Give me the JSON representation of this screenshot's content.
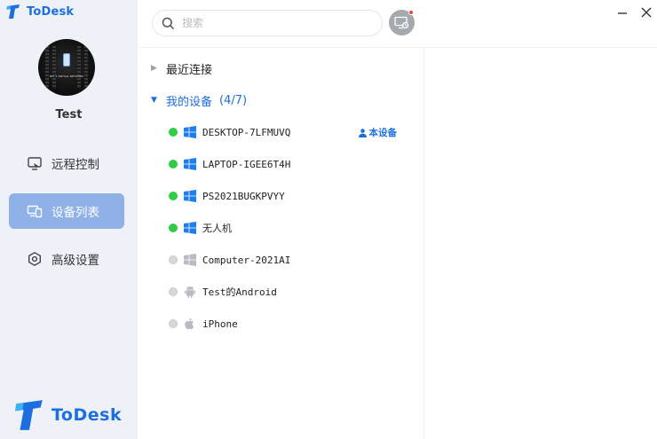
{
  "app": {
    "brand_top": "ToDesk",
    "brand_bottom": "ToDesk",
    "brand_color": "#1d6fe0"
  },
  "user": {
    "name": "Test",
    "avatar_caption": "NO. 1 VIRTUAL NETWORK"
  },
  "sidebar": {
    "items": [
      {
        "label": "远程控制",
        "icon": "remote-control-icon",
        "active": false
      },
      {
        "label": "设备列表",
        "icon": "device-list-icon",
        "active": true
      },
      {
        "label": "高级设置",
        "icon": "settings-icon",
        "active": false
      }
    ]
  },
  "search": {
    "placeholder": "搜索",
    "value": ""
  },
  "header": {
    "remote_button_icon": "remote-desktop-icon",
    "notification_dot": true,
    "minimize_icon": "minimize-icon",
    "close_icon": "close-icon"
  },
  "tree": {
    "recent": {
      "label": "最近连接",
      "expanded": false
    },
    "mine": {
      "label": "我的设备",
      "count": "(4/7)",
      "expanded": true
    },
    "this_device_label": "本设备",
    "devices": [
      {
        "name": "DESKTOP-7LFMUVQ",
        "os": "windows",
        "online": true,
        "is_this_device": true
      },
      {
        "name": "LAPTOP-IGEE6T4H",
        "os": "windows",
        "online": true,
        "is_this_device": false
      },
      {
        "name": "PS2021BUGKPVYY",
        "os": "windows",
        "online": true,
        "is_this_device": false
      },
      {
        "name": "无人机",
        "os": "windows",
        "online": true,
        "is_this_device": false
      },
      {
        "name": "Computer-2021AI",
        "os": "windows",
        "online": false,
        "is_this_device": false
      },
      {
        "name": "Test的Android",
        "os": "android",
        "online": false,
        "is_this_device": false
      },
      {
        "name": "iPhone",
        "os": "apple",
        "online": false,
        "is_this_device": false
      }
    ]
  },
  "colors": {
    "accent": "#1d6fe0",
    "nav_active": "#8fb1e8",
    "online": "#2fcc47",
    "offline": "#d8d8d8",
    "os_online": "#1d7ef0",
    "os_offline": "#b8bcc2",
    "sidebar_bg": "#eef2f8"
  }
}
